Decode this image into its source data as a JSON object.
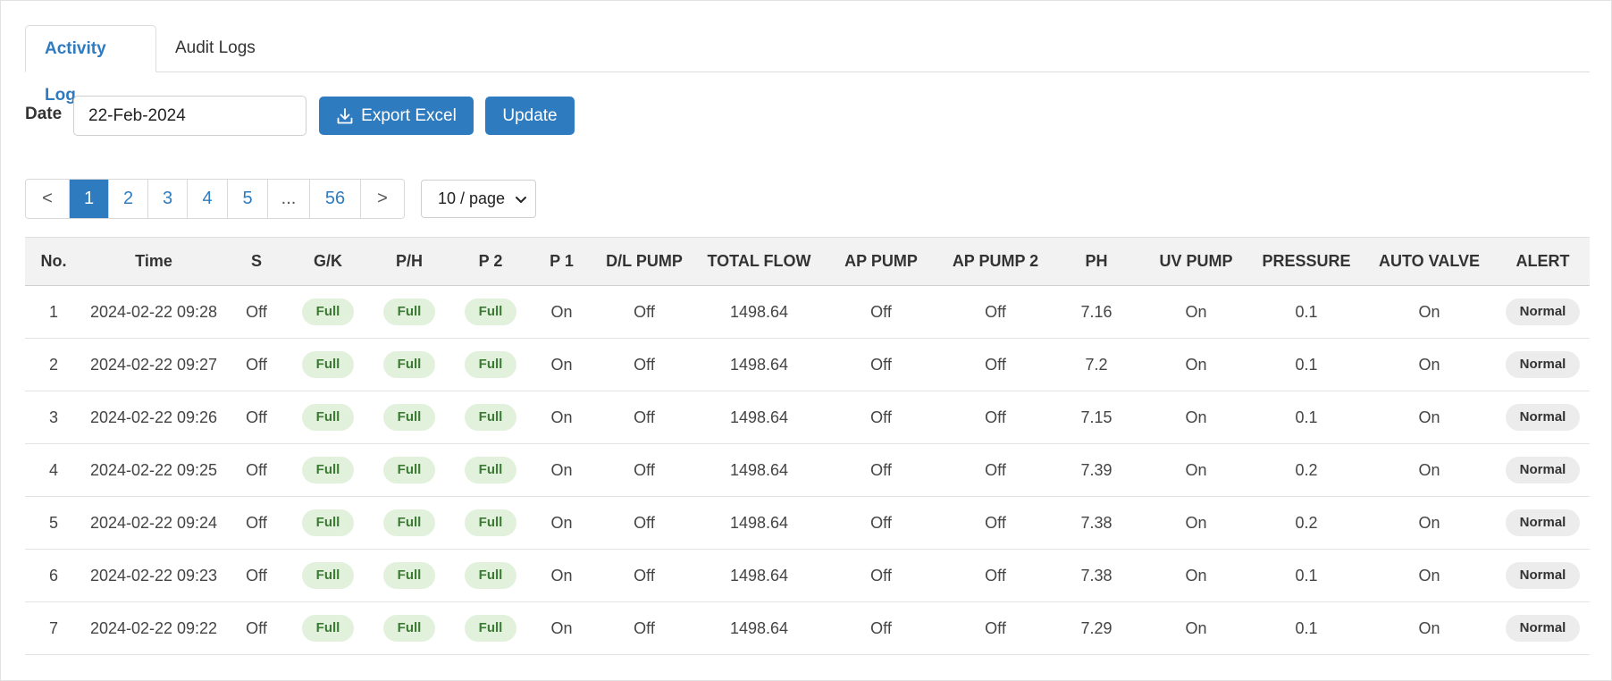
{
  "tabs": [
    {
      "label": "Activity Log",
      "active": true
    },
    {
      "label": "Audit Logs",
      "active": false
    }
  ],
  "filters": {
    "date_label": "Date",
    "date_value": "22-Feb-2024",
    "export_label": "Export Excel",
    "update_label": "Update"
  },
  "pagination": {
    "prev": "<",
    "next": ">",
    "pages": [
      "1",
      "2",
      "3",
      "4",
      "5",
      "...",
      "56"
    ],
    "current": "1",
    "page_size": "10 / page"
  },
  "table": {
    "columns": [
      "No.",
      "Time",
      "S",
      "G/K",
      "P/H",
      "P 2",
      "P 1",
      "D/L PUMP",
      "TOTAL FLOW",
      "AP PUMP",
      "AP PUMP 2",
      "PH",
      "UV PUMP",
      "PRESSURE",
      "AUTO VALVE",
      "ALERT"
    ],
    "rows": [
      [
        "1",
        "2024-02-22 09:28",
        "Off",
        "Full",
        "Full",
        "Full",
        "On",
        "Off",
        "1498.64",
        "Off",
        "Off",
        "7.16",
        "On",
        "0.1",
        "On",
        "Normal"
      ],
      [
        "2",
        "2024-02-22 09:27",
        "Off",
        "Full",
        "Full",
        "Full",
        "On",
        "Off",
        "1498.64",
        "Off",
        "Off",
        "7.2",
        "On",
        "0.1",
        "On",
        "Normal"
      ],
      [
        "3",
        "2024-02-22 09:26",
        "Off",
        "Full",
        "Full",
        "Full",
        "On",
        "Off",
        "1498.64",
        "Off",
        "Off",
        "7.15",
        "On",
        "0.1",
        "On",
        "Normal"
      ],
      [
        "4",
        "2024-02-22 09:25",
        "Off",
        "Full",
        "Full",
        "Full",
        "On",
        "Off",
        "1498.64",
        "Off",
        "Off",
        "7.39",
        "On",
        "0.2",
        "On",
        "Normal"
      ],
      [
        "5",
        "2024-02-22 09:24",
        "Off",
        "Full",
        "Full",
        "Full",
        "On",
        "Off",
        "1498.64",
        "Off",
        "Off",
        "7.38",
        "On",
        "0.2",
        "On",
        "Normal"
      ],
      [
        "6",
        "2024-02-22 09:23",
        "Off",
        "Full",
        "Full",
        "Full",
        "On",
        "Off",
        "1498.64",
        "Off",
        "Off",
        "7.38",
        "On",
        "0.1",
        "On",
        "Normal"
      ],
      [
        "7",
        "2024-02-22 09:22",
        "Off",
        "Full",
        "Full",
        "Full",
        "On",
        "Off",
        "1498.64",
        "Off",
        "Off",
        "7.29",
        "On",
        "0.1",
        "On",
        "Normal"
      ]
    ]
  },
  "colors": {
    "primary": "#2f7bbf",
    "pill_green_bg": "#e1f1dc",
    "pill_green_text": "#3b7a33",
    "alert_bg": "#ececec",
    "header_bg": "#f2f2f2"
  },
  "icons": {
    "export": "download-icon",
    "page_size": "chevron-down-icon"
  }
}
